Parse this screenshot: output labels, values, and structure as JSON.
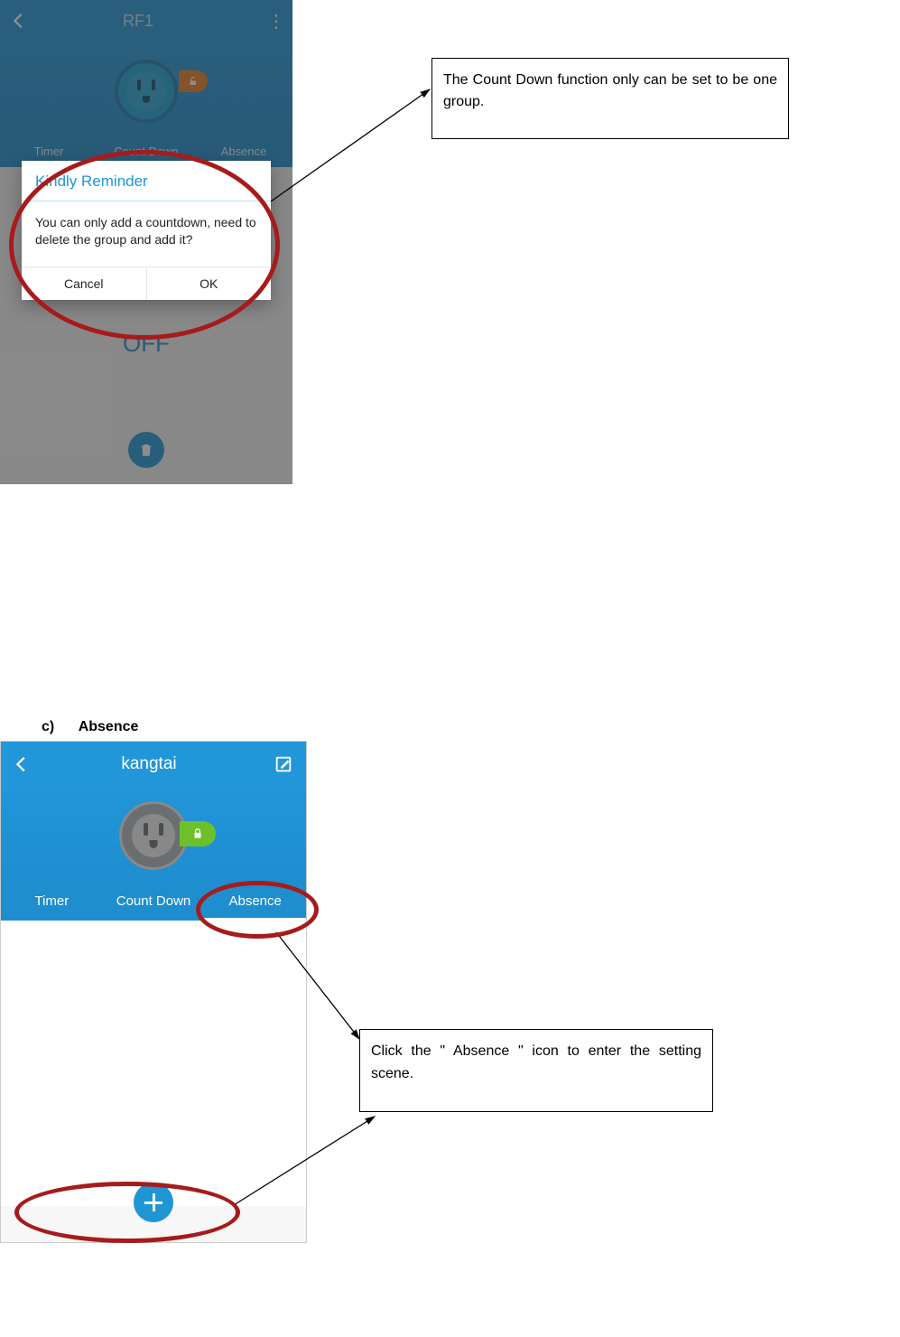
{
  "section": {
    "bullet": "c)",
    "title": "Absence"
  },
  "callout1": "The Count Down function only can be set to be one group.",
  "callout2": "Click  the  \" Absence \"  icon  to  enter  the setting scene.",
  "shot1": {
    "title": "RF1",
    "tabs": {
      "timer": "Timer",
      "countdown": "Count Down",
      "absence": "Absence"
    },
    "off_label": "OFF",
    "dialog": {
      "title": "Kindly Reminder",
      "body": "You can only add a countdown, need to delete the group and add it?",
      "cancel": "Cancel",
      "ok": "OK"
    }
  },
  "shot2": {
    "title": "kangtai",
    "tabs": {
      "timer": "Timer",
      "countdown": "Count Down",
      "absence": "Absence"
    }
  }
}
